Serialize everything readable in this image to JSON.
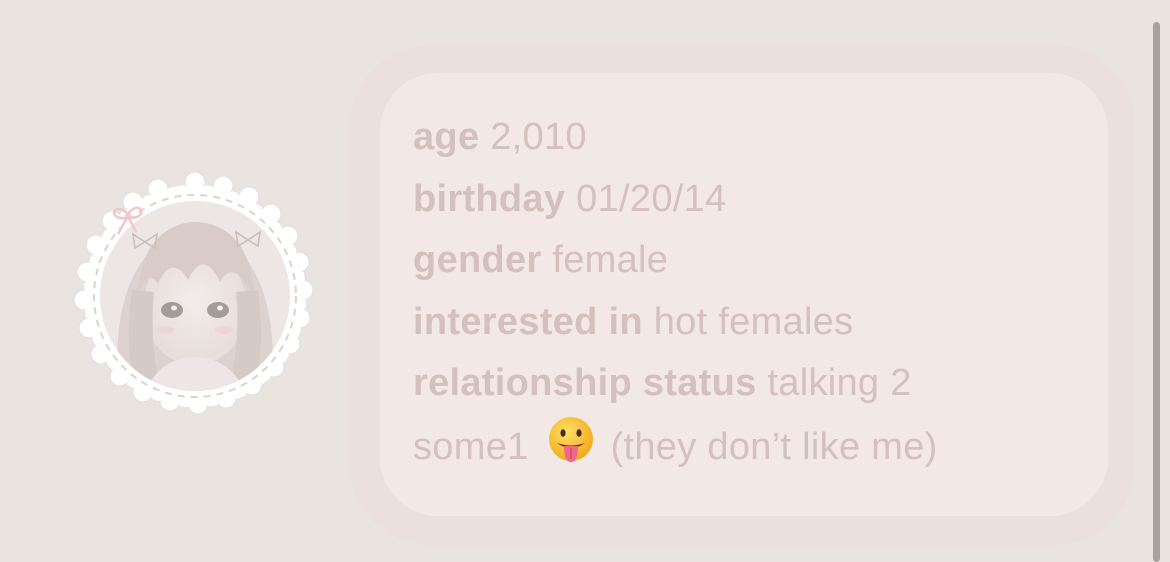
{
  "profile": {
    "avatar_icon": "anime-girl-avatar-icon",
    "fields": [
      {
        "label": "age",
        "value": "2,010"
      },
      {
        "label": "birthday",
        "value": "01/20/14"
      },
      {
        "label": "gender",
        "value": "female"
      },
      {
        "label": "interested in",
        "value": "hot females"
      },
      {
        "label": "relationship status",
        "value": "talking 2"
      }
    ],
    "status_cont_before": "some1",
    "emoji_icon": "tongue-out-emoji-icon",
    "status_cont_after": "(they don’t like me)"
  },
  "colors": {
    "page_bg": "#eae4e1",
    "card_outer": "#ebe0de",
    "card_inner": "#f2e8e6",
    "text": "#d4c0bc",
    "scrollbar": "#a9a3a0"
  }
}
